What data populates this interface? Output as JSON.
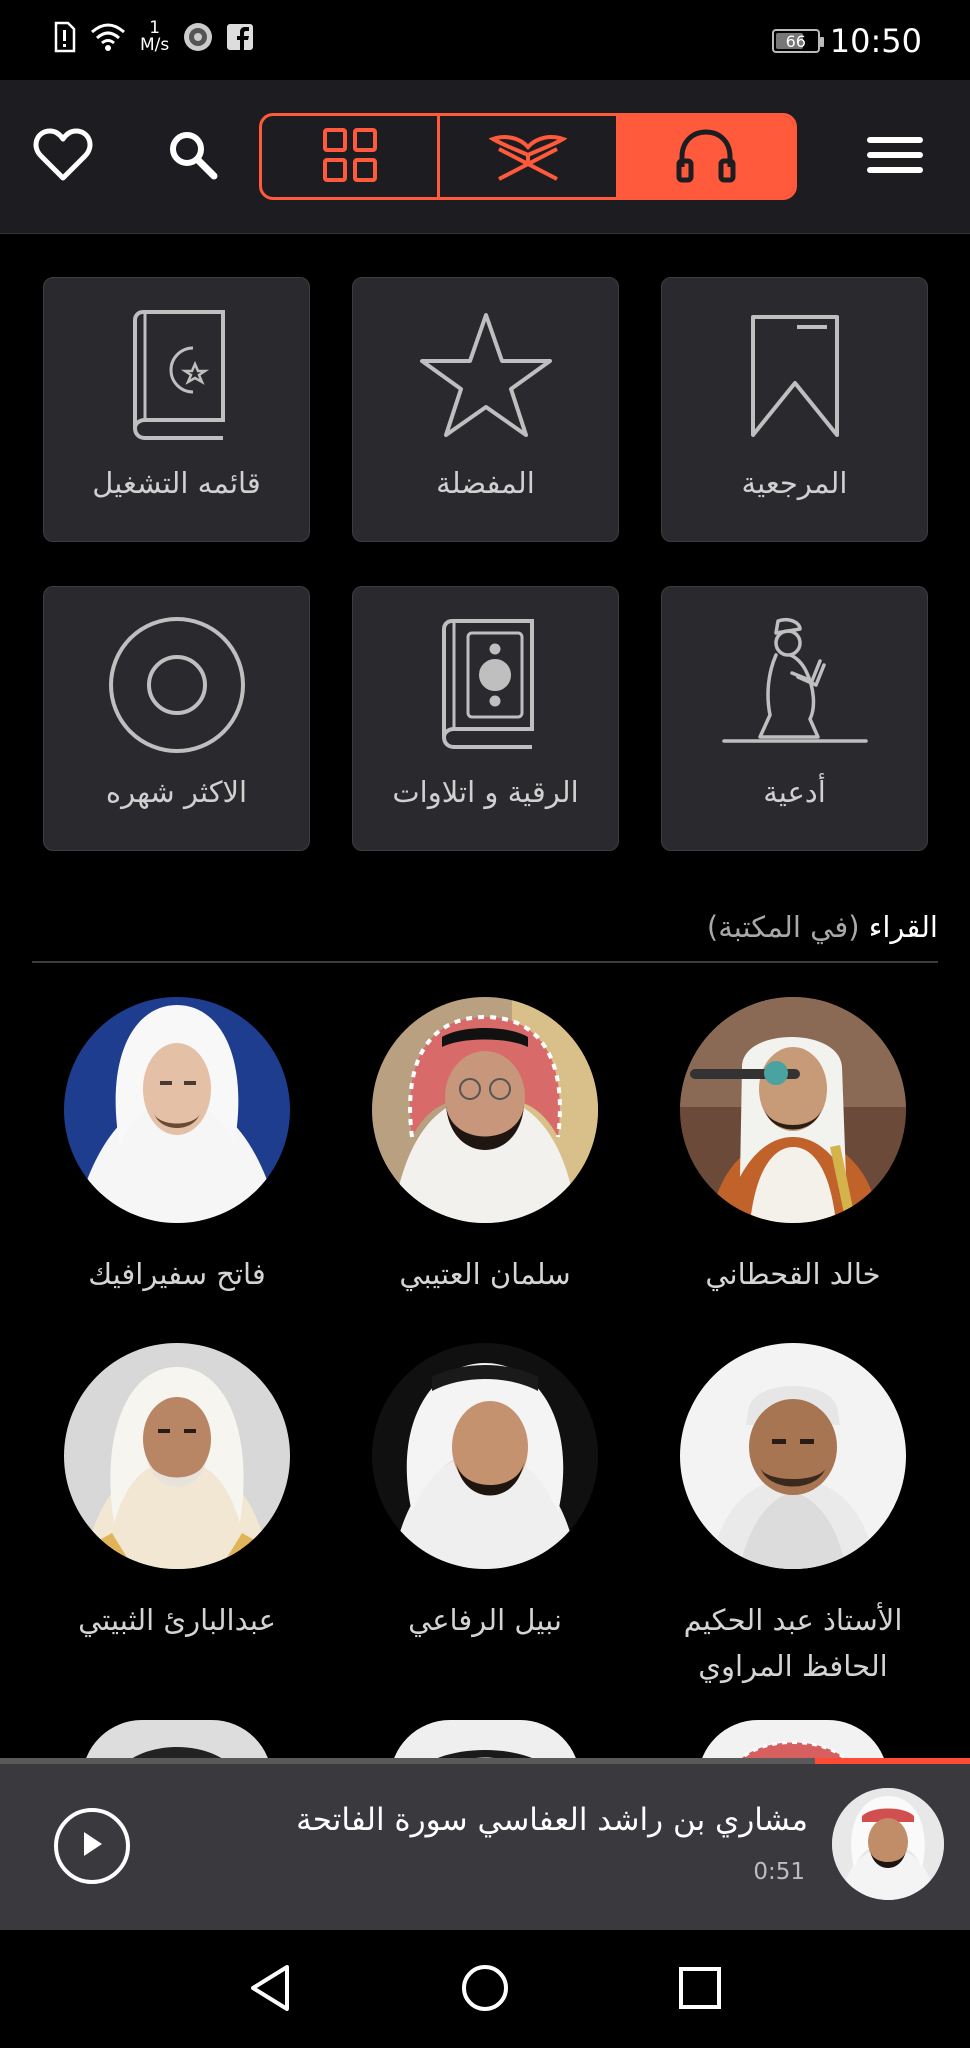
{
  "status_bar": {
    "time": "10:50",
    "battery": "66",
    "speed_value": "1",
    "speed_unit": "M/s",
    "icons": [
      "alert-sim-icon",
      "wifi-icon",
      "network-speed",
      "quran-app-icon",
      "facebook-icon",
      "battery-icon"
    ]
  },
  "header": {
    "icons": [
      "heart-icon",
      "search-icon",
      "grid-icon",
      "quran-book-icon",
      "headphones-icon",
      "menu-icon"
    ],
    "active_tab": "headphones",
    "accent": "#ff5a3c"
  },
  "categories": [
    {
      "label": "المرجعية",
      "icon": "bookmark-icon"
    },
    {
      "label": "المفضلة",
      "icon": "star-icon"
    },
    {
      "label": "قائمه التشغيل",
      "icon": "playlist-book-icon"
    },
    {
      "label": "أدعية",
      "icon": "praying-man-icon"
    },
    {
      "label": "الرقية و اتلاوات",
      "icon": "ruqyah-book-icon"
    },
    {
      "label": "الاكثر شهره",
      "icon": "disc-icon"
    }
  ],
  "readers_section": {
    "title": "القراء",
    "subtitle": "(في المكتبة)"
  },
  "readers": [
    {
      "name": "خالد القحطاني"
    },
    {
      "name": "سلمان العتيبي"
    },
    {
      "name": "فاتح سفيرافيك"
    },
    {
      "name": "الأستاذ عبد الحكيم الحافظ المراوي"
    },
    {
      "name": "نبيل الرفاعي"
    },
    {
      "name": "عبدالبارئ الثبيتي"
    }
  ],
  "player": {
    "title": "مشاري بن راشد العفاسي سورة الفاتحة",
    "time": "0:51",
    "progress": 0.16,
    "state": "paused"
  },
  "nav": {
    "icons": [
      "back-icon",
      "home-icon",
      "recents-icon"
    ]
  }
}
